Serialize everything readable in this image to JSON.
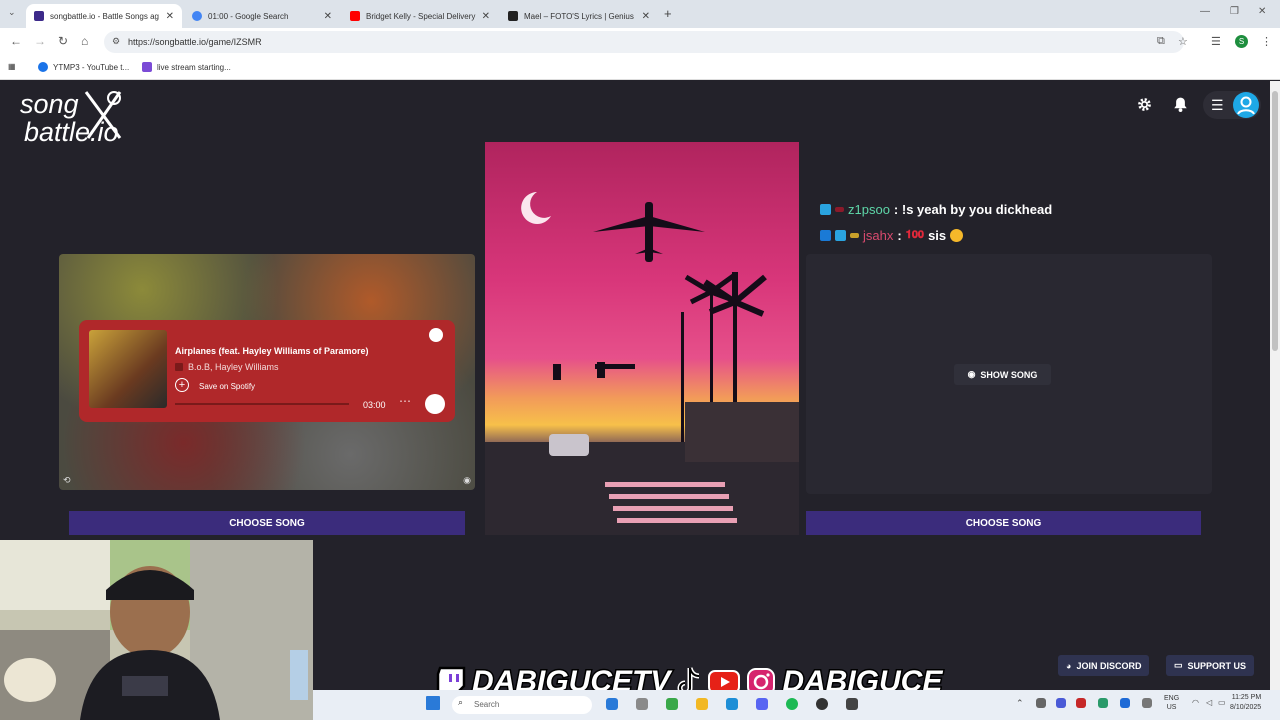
{
  "browser": {
    "tabs": [
      {
        "title": "songbattle.io - Battle Songs ag",
        "active": true,
        "favicon_color": "#3d2a8a"
      },
      {
        "title": "01:00 - Google Search",
        "active": false,
        "favicon_color": "#4285f4"
      },
      {
        "title": "Bridget Kelly - Special Delivery",
        "active": false,
        "favicon_color": "#ff0000"
      },
      {
        "title": "Mael – FOTO'S Lyrics | Genius Ly",
        "active": false,
        "favicon_color": "#222222"
      }
    ],
    "new_tab": "+",
    "url": "https://songbattle.io/game/IZSMR",
    "profile_initial": "S",
    "bookmarks": [
      {
        "label": "YTMP3 - YouTube t...",
        "color": "#1a73e8"
      },
      {
        "label": "live stream starting...",
        "color": "#7b4bd6"
      }
    ]
  },
  "site": {
    "logo_line1": "song",
    "logo_line2": "battle.io"
  },
  "player": {
    "title": "Airplanes (feat. Hayley Williams of Paramore)",
    "artist": "B.o.B, Hayley Williams",
    "save_label": "Save on Spotify",
    "duration": "03:00",
    "progress": 0
  },
  "chat": [
    {
      "user": "z1psoo",
      "message": ": !s yeah by you dickhead"
    },
    {
      "user": "jsahx",
      "message": ":",
      "message2": "sis"
    }
  ],
  "right_panel": {
    "show_song_label": "SHOW SONG"
  },
  "buttons": {
    "choose_left": "CHOOSE SONG",
    "choose_right": "CHOOSE SONG",
    "join_discord": "JOIN DISCORD",
    "support_us": "SUPPORT US"
  },
  "overlay": {
    "channel_left": "DABIGUCETV",
    "channel_right": "DABIGUCE"
  },
  "taskbar": {
    "search_placeholder": "Search",
    "lang_line1": "ENG",
    "lang_line2": "US",
    "time": "11:25 PM",
    "date": "8/10/2025"
  },
  "colors": {
    "page_bg": "#23222a",
    "choose_button": "#3b2c7c",
    "spotify_card": "#b0282a",
    "chat_user1": "#5ed6a8",
    "chat_user2": "#d94a6e"
  }
}
